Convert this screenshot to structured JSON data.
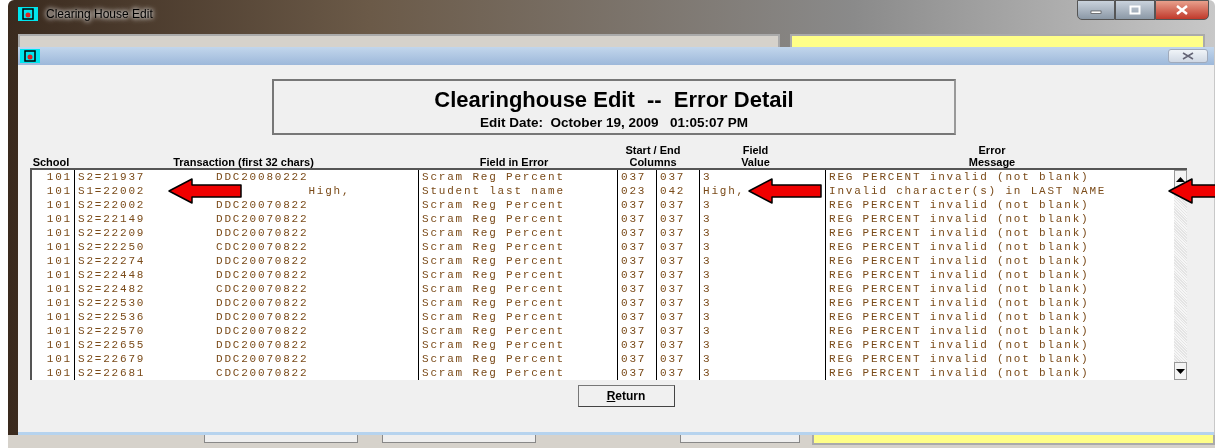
{
  "window": {
    "title": "Clearing House Edit"
  },
  "dialog": {
    "heading": "Clearinghouse Edit  --  Error Detail",
    "subheading": "Edit Date:  October 19, 2009   01:05:07 PM",
    "table": {
      "columns": [
        "School",
        "Transaction  (first 32 chars)",
        "Field in Error",
        "Start / End\nColumns",
        "Field\nValue",
        "Error\nMessage"
      ],
      "rows": [
        {
          "school": "101",
          "transaction_id": "S2=21937",
          "transaction_data": "DDC20080222",
          "field": "Scram Reg Percent",
          "start": "037",
          "end": "037",
          "value": "3",
          "message": "REG PERCENT invalid (not blank)",
          "flagged": false
        },
        {
          "school": "101",
          "transaction_id": "S1=22002",
          "transaction_data": "           High,",
          "field": "Student last name",
          "start": "023",
          "end": "042",
          "value": "High,",
          "message": "Invalid character(s) in LAST NAME",
          "flagged": true
        },
        {
          "school": "101",
          "transaction_id": "S2=22002",
          "transaction_data": "DDC20070822",
          "field": "Scram Reg Percent",
          "start": "037",
          "end": "037",
          "value": "3",
          "message": "REG PERCENT invalid (not blank)",
          "flagged": false
        },
        {
          "school": "101",
          "transaction_id": "S2=22149",
          "transaction_data": "DDC20070822",
          "field": "Scram Reg Percent",
          "start": "037",
          "end": "037",
          "value": "3",
          "message": "REG PERCENT invalid (not blank)",
          "flagged": false
        },
        {
          "school": "101",
          "transaction_id": "S2=22209",
          "transaction_data": "DDC20070822",
          "field": "Scram Reg Percent",
          "start": "037",
          "end": "037",
          "value": "3",
          "message": "REG PERCENT invalid (not blank)",
          "flagged": false
        },
        {
          "school": "101",
          "transaction_id": "S2=22250",
          "transaction_data": "CDC20070822",
          "field": "Scram Reg Percent",
          "start": "037",
          "end": "037",
          "value": "3",
          "message": "REG PERCENT invalid (not blank)",
          "flagged": false
        },
        {
          "school": "101",
          "transaction_id": "S2=22274",
          "transaction_data": "DDC20070822",
          "field": "Scram Reg Percent",
          "start": "037",
          "end": "037",
          "value": "3",
          "message": "REG PERCENT invalid (not blank)",
          "flagged": false
        },
        {
          "school": "101",
          "transaction_id": "S2=22448",
          "transaction_data": "DDC20070822",
          "field": "Scram Reg Percent",
          "start": "037",
          "end": "037",
          "value": "3",
          "message": "REG PERCENT invalid (not blank)",
          "flagged": false
        },
        {
          "school": "101",
          "transaction_id": "S2=22482",
          "transaction_data": "CDC20070822",
          "field": "Scram Reg Percent",
          "start": "037",
          "end": "037",
          "value": "3",
          "message": "REG PERCENT invalid (not blank)",
          "flagged": false
        },
        {
          "school": "101",
          "transaction_id": "S2=22530",
          "transaction_data": "DDC20070822",
          "field": "Scram Reg Percent",
          "start": "037",
          "end": "037",
          "value": "3",
          "message": "REG PERCENT invalid (not blank)",
          "flagged": false
        },
        {
          "school": "101",
          "transaction_id": "S2=22536",
          "transaction_data": "DDC20070822",
          "field": "Scram Reg Percent",
          "start": "037",
          "end": "037",
          "value": "3",
          "message": "REG PERCENT invalid (not blank)",
          "flagged": false
        },
        {
          "school": "101",
          "transaction_id": "S2=22570",
          "transaction_data": "DDC20070822",
          "field": "Scram Reg Percent",
          "start": "037",
          "end": "037",
          "value": "3",
          "message": "REG PERCENT invalid (not blank)",
          "flagged": false
        },
        {
          "school": "101",
          "transaction_id": "S2=22655",
          "transaction_data": "DDC20070822",
          "field": "Scram Reg Percent",
          "start": "037",
          "end": "037",
          "value": "3",
          "message": "REG PERCENT invalid (not blank)",
          "flagged": false
        },
        {
          "school": "101",
          "transaction_id": "S2=22679",
          "transaction_data": "DDC20070822",
          "field": "Scram Reg Percent",
          "start": "037",
          "end": "037",
          "value": "3",
          "message": "REG PERCENT invalid (not blank)",
          "flagged": false
        },
        {
          "school": "101",
          "transaction_id": "S2=22681",
          "transaction_data": "CDC20070822",
          "field": "Scram Reg Percent",
          "start": "037",
          "end": "037",
          "value": "3",
          "message": "REG PERCENT invalid (not blank)",
          "flagged": false
        }
      ]
    },
    "buttons": [
      {
        "label": "Return"
      }
    ]
  }
}
